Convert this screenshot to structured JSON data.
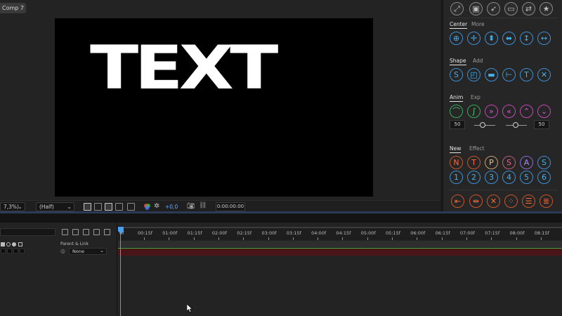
{
  "viewer": {
    "comp_tab": "Comp 7",
    "canvas_text": "TEXT",
    "zoom": "7,3%)",
    "resolution": "(Half)",
    "exposure": "+0,0",
    "timecode": "0:00:00:00"
  },
  "panel": {
    "top_icons": [
      "expand-icon",
      "video-icon",
      "rocket-icon",
      "folder-icon",
      "swap-icon",
      "star-icon"
    ],
    "center_tabs": [
      "Center",
      "More"
    ],
    "shape_tabs": [
      "Shape",
      "Add"
    ],
    "anim_tabs": [
      "Anim",
      "Exp"
    ],
    "new_tabs": [
      "New",
      "Effect"
    ],
    "anim_left_value": "50",
    "anim_right_value": "50",
    "new_letters": [
      "N",
      "T",
      "P",
      "S",
      "A",
      "S"
    ],
    "new_numbers": [
      "1",
      "2",
      "3",
      "4",
      "5",
      "6"
    ]
  },
  "timeline": {
    "parent_link_header": "Parent & Link",
    "parent_value": "None",
    "ruler_labels": [
      "00:15f",
      "01:00f",
      "01:15f",
      "02:00f",
      "02:15f",
      "03:00f",
      "03:15f",
      "04:00f",
      "04:15f",
      "05:00f",
      "05:15f",
      "06:00f",
      "06:15f",
      "07:00f",
      "07:15f",
      "08:00f",
      "08:15f"
    ],
    "ruler_first": "0f"
  },
  "colors": {
    "accent_blue": "#4a9ff5",
    "green": "#4fd07a",
    "pink": "#e05ad2",
    "orange": "#ff6a36",
    "layer_bar": "#4a1518"
  }
}
